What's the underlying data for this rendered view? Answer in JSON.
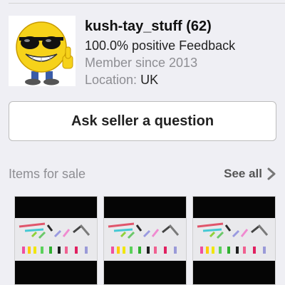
{
  "seller": {
    "name": "kush-tay_stuff (62)",
    "feedback": "100.0% positive Feedback",
    "member_since": "Member since 2013",
    "location_label": "Location:",
    "location_value": "UK",
    "avatar_icon": "cool-smiley-thumbs-up-icon"
  },
  "actions": {
    "ask_label": "Ask seller a question"
  },
  "items_for_sale": {
    "title": "Items for sale",
    "see_all_label": "See all",
    "see_all_icon": "chevron-right-icon",
    "thumbnails": [
      {
        "name": "item-thumbnail-1"
      },
      {
        "name": "item-thumbnail-2"
      },
      {
        "name": "item-thumbnail-3"
      }
    ]
  },
  "colors": {
    "background": "#efeff4",
    "button_border": "#bdbdbd",
    "muted_text": "#8e8e93"
  }
}
